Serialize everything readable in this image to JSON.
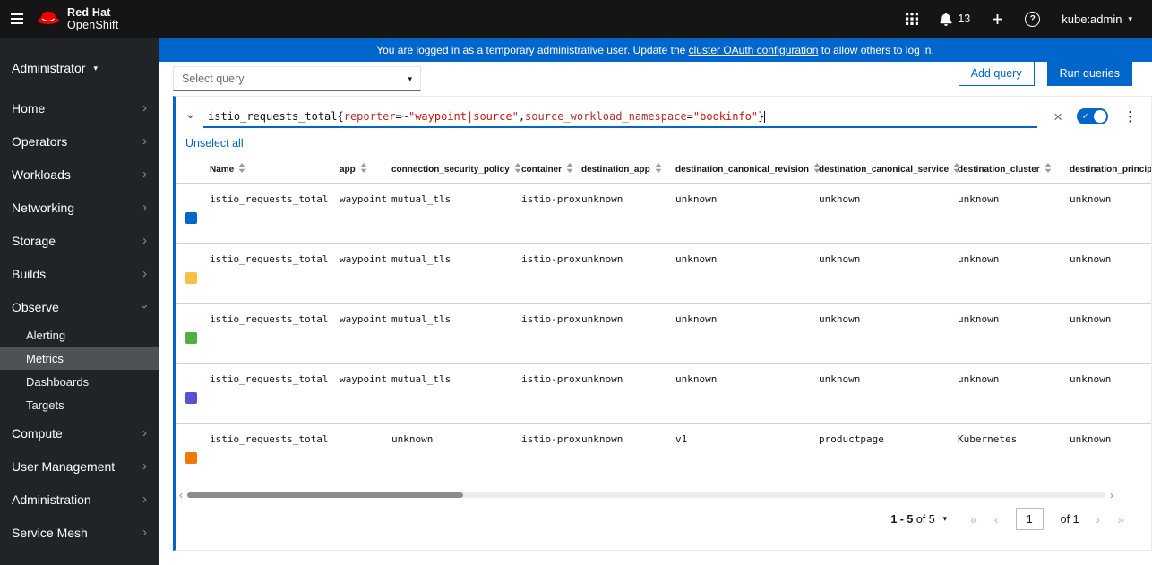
{
  "masthead": {
    "brand_top": "Red Hat",
    "brand_bottom": "OpenShift",
    "notification_count": "13",
    "user_menu_label": "kube:admin"
  },
  "banner": {
    "prefix": "You are logged in as a temporary administrative user. Update the ",
    "link_text": "cluster OAuth configuration",
    "suffix": " to allow others to log in."
  },
  "sidebar": {
    "perspective": "Administrator",
    "items": [
      {
        "label": "Home",
        "expanded": false
      },
      {
        "label": "Operators",
        "expanded": false
      },
      {
        "label": "Workloads",
        "expanded": false
      },
      {
        "label": "Networking",
        "expanded": false
      },
      {
        "label": "Storage",
        "expanded": false
      },
      {
        "label": "Builds",
        "expanded": false
      },
      {
        "label": "Observe",
        "expanded": true,
        "children": [
          "Alerting",
          "Metrics",
          "Dashboards",
          "Targets"
        ],
        "selected_child": "Metrics"
      },
      {
        "label": "Compute",
        "expanded": false
      },
      {
        "label": "User Management",
        "expanded": false
      },
      {
        "label": "Administration",
        "expanded": false
      },
      {
        "label": "Service Mesh",
        "expanded": false
      }
    ]
  },
  "toolbar": {
    "select_query_label": "Select query",
    "add_query_label": "Add query",
    "run_queries_label": "Run queries"
  },
  "query": {
    "expression_tokens": [
      {
        "text": "istio_requests_total",
        "type": "metric"
      },
      {
        "text": "{",
        "type": "brace"
      },
      {
        "text": "reporter",
        "type": "label"
      },
      {
        "text": "=~",
        "type": "op"
      },
      {
        "text": "\"waypoint|source\"",
        "type": "string"
      },
      {
        "text": ",",
        "type": "brace"
      },
      {
        "text": "source_workload_namespace",
        "type": "label"
      },
      {
        "text": "=",
        "type": "op"
      },
      {
        "text": "\"bookinfo\"",
        "type": "string"
      },
      {
        "text": "}",
        "type": "brace"
      }
    ],
    "unselect_all_label": "Unselect all",
    "switch_enabled": true
  },
  "table": {
    "columns": [
      "Name",
      "app",
      "connection_security_policy",
      "container",
      "destination_app",
      "destination_canonical_revision",
      "destination_canonical_service",
      "destination_cluster",
      "destination_principal"
    ],
    "rows": [
      {
        "color": "#0066cc",
        "values": [
          "istio_requests_total",
          "waypoint",
          "mutual_tls",
          "istio-proxy",
          "unknown",
          "unknown",
          "unknown",
          "unknown",
          "unknown"
        ]
      },
      {
        "color": "#f4c145",
        "values": [
          "istio_requests_total",
          "waypoint",
          "mutual_tls",
          "istio-proxy",
          "unknown",
          "unknown",
          "unknown",
          "unknown",
          "unknown"
        ]
      },
      {
        "color": "#4cb140",
        "values": [
          "istio_requests_total",
          "waypoint",
          "mutual_tls",
          "istio-proxy",
          "unknown",
          "unknown",
          "unknown",
          "unknown",
          "unknown"
        ]
      },
      {
        "color": "#5752d1",
        "values": [
          "istio_requests_total",
          "waypoint",
          "mutual_tls",
          "istio-proxy",
          "unknown",
          "unknown",
          "unknown",
          "unknown",
          "unknown"
        ]
      },
      {
        "color": "#ec7a08",
        "values": [
          "istio_requests_total",
          "",
          "unknown",
          "istio-proxy",
          "unknown",
          "v1",
          "productpage",
          "Kubernetes",
          "unknown"
        ]
      }
    ]
  },
  "pagination": {
    "range_label": "1 - 5",
    "range_of_label": "of 5",
    "current_page": "1",
    "page_of_label": "of 1"
  },
  "icons": {
    "caret_down": "▾",
    "chevron": "›",
    "kebab": "⋮",
    "clear": "×",
    "check": "✓",
    "question": "?",
    "first_page": "«",
    "prev_page": "‹",
    "next_page": "›",
    "last_page": "»"
  },
  "colors": {
    "accent_blue": "#0066cc"
  }
}
